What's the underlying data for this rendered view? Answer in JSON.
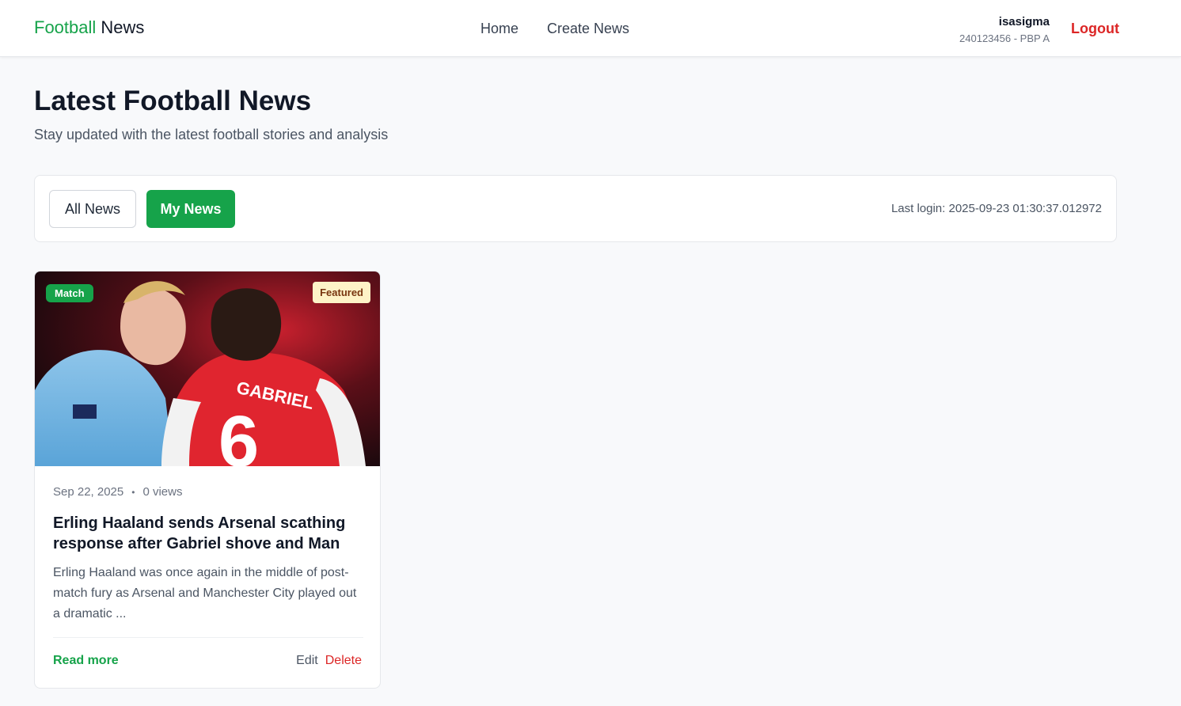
{
  "navbar": {
    "brand_part1": "Football",
    "brand_part2": "News",
    "links": [
      "Home",
      "Create News"
    ],
    "user": {
      "name": "isasigma",
      "subtitle": "240123456 - PBP A"
    },
    "logout_label": "Logout"
  },
  "header": {
    "title": "Latest Football News",
    "subtitle": "Stay updated with the latest football stories and analysis"
  },
  "filters": {
    "all_label": "All News",
    "my_label": "My News",
    "active": "My News",
    "last_login": "Last login: 2025-09-23 01:30:37.012972"
  },
  "news": [
    {
      "category_badge": "Match",
      "featured_badge": "Featured",
      "image_shirt_text": "GABRIEL",
      "image_shirt_number": "6",
      "date": "Sep 22, 2025",
      "separator": "•",
      "views": "0 views",
      "title": "Erling Haaland sends Arsenal scathing response after Gabriel shove and Man Ci...",
      "excerpt": "Erling Haaland was once again in the middle of post-match fury as Arsenal and Manchester City played out a dramatic ...",
      "read_more": "Read more",
      "edit_label": "Edit",
      "delete_label": "Delete"
    }
  ],
  "colors": {
    "accent_green": "#16a34a",
    "danger_red": "#dc2626",
    "featured_bg": "#fef3c7"
  }
}
